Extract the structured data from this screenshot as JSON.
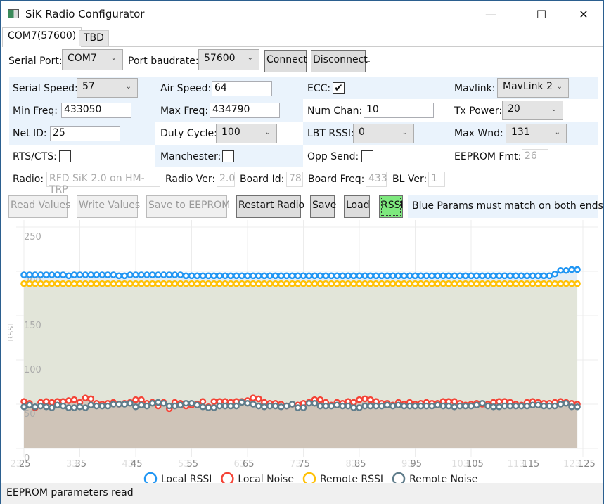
{
  "window": {
    "title": "SiK Radio Configurator",
    "minimize": "—",
    "maximize": "☐",
    "close": "✕"
  },
  "tabs": [
    {
      "label": "COM7(57600)",
      "active": true
    },
    {
      "label": "TBD",
      "active": false
    }
  ],
  "serial": {
    "port_label": "Serial Port:",
    "port_value": "COM7",
    "baud_label": "Port baudrate:",
    "baud_value": "57600",
    "connect": "Connect",
    "disconnect": "Disconnect"
  },
  "params": {
    "serial_speed": {
      "label": "Serial Speed:",
      "value": "57"
    },
    "air_speed": {
      "label": "Air Speed:",
      "value": "64"
    },
    "ecc": {
      "label": "ECC:",
      "checked": true,
      "mark": "✔"
    },
    "mavlink": {
      "label": "Mavlink:",
      "value": "MavLink 2"
    },
    "min_freq": {
      "label": "Min Freq:",
      "value": "433050"
    },
    "max_freq": {
      "label": "Max Freq:",
      "value": "434790"
    },
    "num_chan": {
      "label": "Num Chan:",
      "value": "10"
    },
    "tx_power": {
      "label": "Tx Power:",
      "value": "20"
    },
    "net_id": {
      "label": "Net ID:",
      "value": "25"
    },
    "duty_cycle": {
      "label": "Duty Cycle:",
      "value": "100"
    },
    "lbt_rssi": {
      "label": "LBT RSSI:",
      "value": "0"
    },
    "max_wnd": {
      "label": "Max Wnd:",
      "value": "131"
    },
    "rts_cts": {
      "label": "RTS/CTS:",
      "checked": false
    },
    "manchester": {
      "label": "Manchester:",
      "checked": false
    },
    "opp_send": {
      "label": "Opp Send:",
      "checked": false
    },
    "eeprom_fmt": {
      "label": "EEPROM Fmt:",
      "value": "26"
    }
  },
  "info": {
    "radio_label": "Radio:",
    "radio": "RFD SiK 2.0 on HM-TRP",
    "radio_ver_label": "Radio Ver:",
    "radio_ver": "2.0",
    "board_id_label": "Board Id:",
    "board_id": "78",
    "board_freq_label": "Board Freq:",
    "board_freq": "433",
    "bl_ver_label": "BL Ver:",
    "bl_ver": "1"
  },
  "actions": {
    "read": "Read Values",
    "write": "Write Values",
    "save_eeprom": "Save to EEPROM",
    "restart": "Restart Radio",
    "save": "Save",
    "load": "Load",
    "rssi": "RSSI",
    "note": "Blue Params must match on both ends!"
  },
  "status": "EEPROM parameters read",
  "chart_data": {
    "type": "line",
    "ylabel": "RSSI",
    "ylim": [
      0,
      250
    ],
    "xlim": [
      25,
      125
    ],
    "yticks": [
      0,
      50,
      100,
      150,
      200,
      250
    ],
    "xticks": [
      25,
      35,
      45,
      55,
      65,
      75,
      85,
      95,
      105,
      115,
      125
    ],
    "xticks_faded": [
      23,
      33,
      43,
      53,
      63,
      73,
      83,
      93,
      103,
      113,
      123
    ],
    "grid": true,
    "legend": "bottom",
    "x_start": 25,
    "series": [
      {
        "name": "Local RSSI",
        "color": "#2196f3",
        "values": [
          196,
          196,
          196,
          196,
          196,
          196,
          196,
          196,
          195,
          196,
          196,
          196,
          196,
          196,
          196,
          196,
          196,
          195,
          195,
          196,
          196,
          196,
          196,
          196,
          196,
          196,
          196,
          196,
          196,
          195,
          195,
          195,
          195,
          195,
          195,
          195,
          195,
          195,
          195,
          195,
          195,
          195,
          195,
          195,
          195,
          195,
          195,
          195,
          195,
          195,
          195,
          195,
          195,
          195,
          195,
          195,
          195,
          195,
          195,
          195,
          195,
          195,
          195,
          195,
          195,
          195,
          195,
          195,
          195,
          195,
          195,
          195,
          195,
          195,
          195,
          195,
          195,
          195,
          195,
          195,
          195,
          195,
          195,
          195,
          195,
          195,
          195,
          195,
          195,
          195,
          195,
          195,
          195,
          195,
          195,
          197,
          201,
          201,
          202,
          202
        ]
      },
      {
        "name": "Local Noise",
        "color": "#f44336",
        "values": [
          53,
          51,
          46,
          52,
          53,
          52,
          53,
          53,
          54,
          55,
          52,
          57,
          56,
          51,
          50,
          51,
          52,
          50,
          51,
          52,
          55,
          55,
          51,
          52,
          48,
          52,
          45,
          52,
          51,
          48,
          49,
          50,
          53,
          47,
          53,
          53,
          53,
          52,
          53,
          53,
          54,
          57,
          56,
          52,
          51,
          51,
          50,
          48,
          50,
          49,
          51,
          52,
          55,
          55,
          52,
          49,
          52,
          51,
          53,
          52,
          55,
          56,
          55,
          53,
          51,
          51,
          49,
          52,
          50,
          52,
          50,
          51,
          52,
          51,
          51,
          53,
          53,
          53,
          51,
          49,
          50,
          51,
          50,
          50,
          52,
          53,
          53,
          52,
          50,
          49,
          52,
          53,
          52,
          51,
          51,
          52,
          53,
          52,
          51,
          50
        ]
      },
      {
        "name": "Remote RSSI",
        "color": "#ffc107",
        "values": [
          186,
          186,
          186,
          186,
          186,
          186,
          186,
          186,
          186,
          186,
          186,
          186,
          186,
          186,
          186,
          186,
          186,
          186,
          186,
          186,
          186,
          186,
          186,
          186,
          186,
          186,
          186,
          186,
          186,
          186,
          186,
          186,
          186,
          186,
          186,
          186,
          186,
          186,
          186,
          186,
          186,
          186,
          186,
          186,
          186,
          186,
          186,
          186,
          186,
          186,
          186,
          186,
          186,
          186,
          186,
          186,
          186,
          186,
          186,
          186,
          186,
          186,
          186,
          186,
          186,
          186,
          186,
          186,
          186,
          186,
          186,
          186,
          186,
          186,
          186,
          186,
          186,
          186,
          186,
          186,
          186,
          186,
          186,
          186,
          186,
          186,
          186,
          186,
          186,
          186,
          186,
          186,
          186,
          186,
          186,
          186,
          186,
          186,
          186,
          186
        ]
      },
      {
        "name": "Remote Noise",
        "color": "#607d8b",
        "values": [
          47,
          49,
          47,
          48,
          47,
          46,
          49,
          48,
          46,
          46,
          47,
          46,
          49,
          48,
          48,
          48,
          50,
          50,
          50,
          51,
          47,
          49,
          48,
          51,
          52,
          51,
          48,
          48,
          49,
          51,
          51,
          49,
          47,
          46,
          46,
          48,
          48,
          48,
          48,
          52,
          51,
          50,
          48,
          47,
          48,
          48,
          47,
          48,
          50,
          46,
          46,
          51,
          51,
          48,
          48,
          48,
          49,
          48,
          48,
          46,
          46,
          48,
          48,
          48,
          48,
          49,
          48,
          49,
          48,
          48,
          48,
          48,
          48,
          48,
          49,
          48,
          48,
          47,
          48,
          48,
          48,
          49,
          51,
          48,
          47,
          47,
          48,
          48,
          48,
          48,
          48,
          49,
          49,
          48,
          48,
          48,
          50,
          51,
          47,
          47
        ]
      }
    ]
  }
}
